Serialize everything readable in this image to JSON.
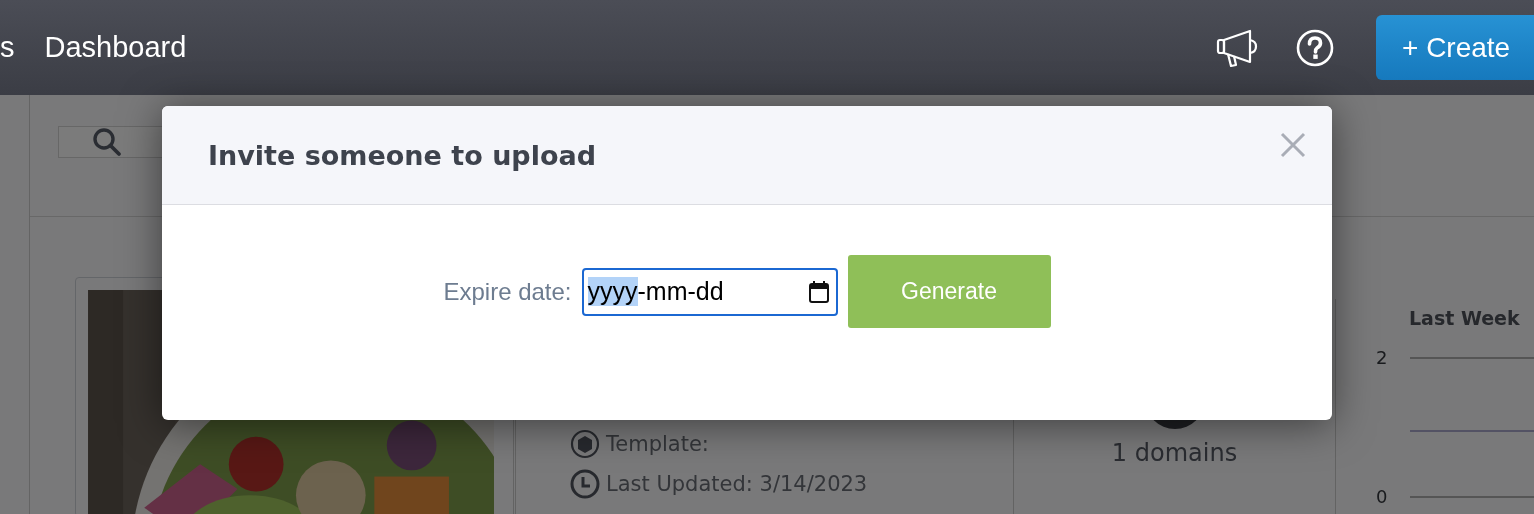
{
  "top_nav": {
    "items": [
      {
        "label": "s"
      },
      {
        "label": "Dashboard"
      }
    ],
    "create_button": "+ Create"
  },
  "background": {
    "template_label": "Template:",
    "last_updated": "Last Updated: 3/14/2023",
    "domains": "1 domains",
    "chart_panel": {
      "title": "Last Week",
      "y_ticks": [
        "2",
        "0"
      ]
    }
  },
  "modal": {
    "title": "Invite someone to upload",
    "expire_label": "Expire date:",
    "date_field": {
      "segments": [
        {
          "text": "yyyy",
          "selected": true
        },
        {
          "text": "-mm-dd",
          "selected": false
        }
      ]
    },
    "generate_button": "Generate"
  }
}
